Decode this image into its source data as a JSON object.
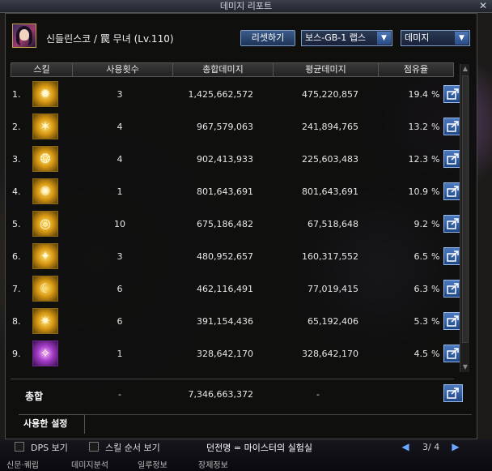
{
  "window": {
    "title": "데미지 리포트"
  },
  "header": {
    "character": "신들린스코 / 罠 무녀 (Lv.110)",
    "reset_label": "리셋하기",
    "dungeon_select": "보스-GB-1 랩스",
    "metric_select": "데미지"
  },
  "columns": {
    "skill": "스킬",
    "count": "사용횟수",
    "total": "총합데미지",
    "average": "평균데미지",
    "share": "점유율"
  },
  "rows": [
    {
      "num": "1.",
      "icon": "burst-icon",
      "count": "3",
      "total": "1,425,662,572",
      "average": "475,220,857",
      "share": "19.4",
      "unit": "%"
    },
    {
      "num": "2.",
      "icon": "strike-icon",
      "count": "4",
      "total": "967,579,063",
      "average": "241,894,765",
      "share": "13.2",
      "unit": "%"
    },
    {
      "num": "3.",
      "icon": "beast-icon",
      "count": "4",
      "total": "902,413,933",
      "average": "225,603,483",
      "share": "12.3",
      "unit": "%"
    },
    {
      "num": "4.",
      "icon": "radiant-icon",
      "count": "1",
      "total": "801,643,691",
      "average": "801,643,691",
      "share": "10.9",
      "unit": "%"
    },
    {
      "num": "5.",
      "icon": "spiral-icon",
      "count": "10",
      "total": "675,186,482",
      "average": "67,518,648",
      "share": "9.2",
      "unit": "%"
    },
    {
      "num": "6.",
      "icon": "flare-icon",
      "count": "3",
      "total": "480,952,657",
      "average": "160,317,552",
      "share": "6.5",
      "unit": "%"
    },
    {
      "num": "7.",
      "icon": "crescent-icon",
      "count": "6",
      "total": "462,116,491",
      "average": "77,019,415",
      "share": "6.3",
      "unit": "%"
    },
    {
      "num": "8.",
      "icon": "swirl-icon",
      "count": "6",
      "total": "391,154,436",
      "average": "65,192,406",
      "share": "5.3",
      "unit": "%"
    },
    {
      "num": "9.",
      "icon": "arcane-icon",
      "count": "1",
      "total": "328,642,170",
      "average": "328,642,170",
      "share": "4.5",
      "unit": "%"
    }
  ],
  "total": {
    "label": "총합",
    "count": "-",
    "total": "7,346,663,372",
    "average": "-"
  },
  "settings": {
    "tab_label": "사용한 설정"
  },
  "bottom": {
    "dps_label": "DPS 보기",
    "order_label": "스킬 순서 보기",
    "dungeon_label": "던전명 = 마이스터의 실험실",
    "page": "3/ 4",
    "menus": [
      "신문·퀘립",
      "데미지분석",
      "일루정보",
      "장제정보"
    ]
  }
}
